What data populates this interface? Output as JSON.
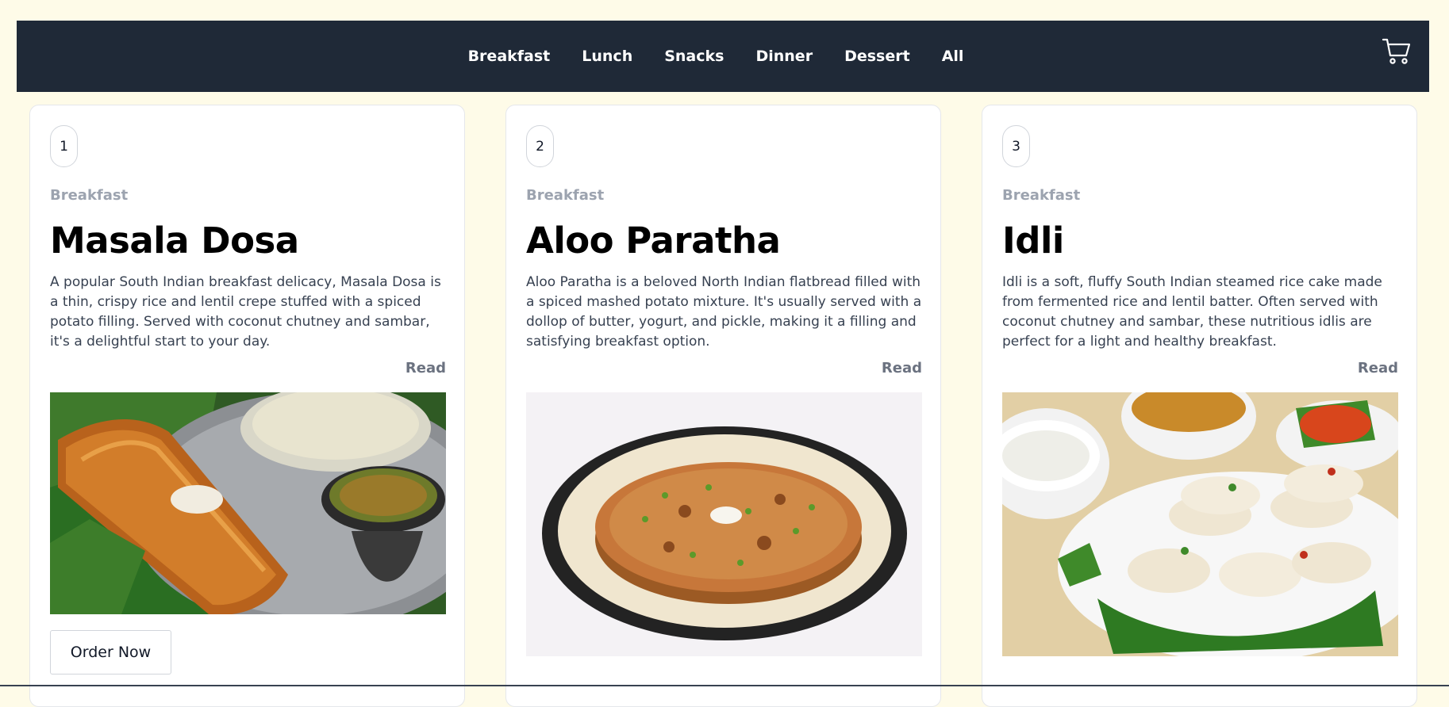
{
  "nav": {
    "items": [
      "Breakfast",
      "Lunch",
      "Snacks",
      "Dinner",
      "Dessert",
      "All"
    ],
    "cart_icon": "cart-icon",
    "background": "#1f2937"
  },
  "cards": [
    {
      "number": "1",
      "category": "Breakfast",
      "title": "Masala Dosa",
      "description": "A popular South Indian breakfast delicacy, Masala Dosa is a thin, crispy rice and lentil crepe stuffed with a spiced potato filling. Served with coconut chutney and sambar, it's a delightful start to your day.",
      "read_label": "Read",
      "image": "masala-dosa-photo",
      "order_label": "Order Now"
    },
    {
      "number": "2",
      "category": "Breakfast",
      "title": "Aloo Paratha",
      "description": "Aloo Paratha is a beloved North Indian flatbread filled with a spiced mashed potato mixture. It's usually served with a dollop of butter, yogurt, and pickle, making it a filling and satisfying breakfast option.",
      "read_label": "Read",
      "image": "aloo-paratha-photo"
    },
    {
      "number": "3",
      "category": "Breakfast",
      "title": "Idli",
      "description": "Idli is a soft, fluffy South Indian steamed rice cake made from fermented rice and lentil batter. Often served with coconut chutney and sambar, these nutritious idlis are perfect for a light and healthy breakfast.",
      "read_label": "Read",
      "image": "idli-photo"
    }
  ]
}
